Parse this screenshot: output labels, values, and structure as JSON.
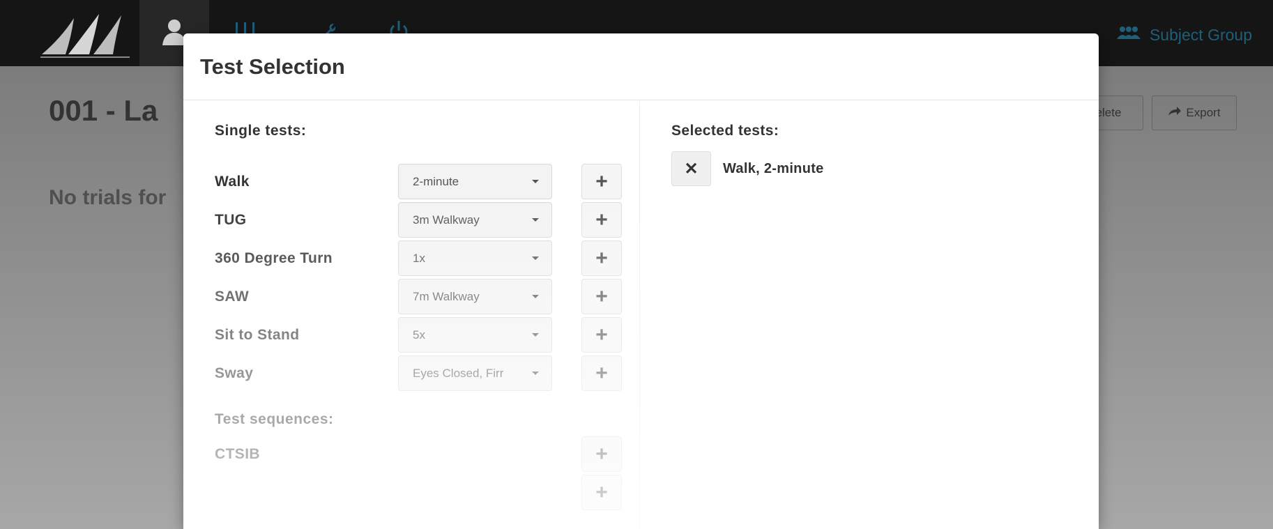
{
  "nav": {
    "subject_group_label": "Subject Group",
    "icons": [
      "logo",
      "user-icon",
      "sliders-icon",
      "wrench-icon",
      "power-icon",
      "users-icon"
    ]
  },
  "background": {
    "title": "001 - La",
    "no_trials": "No trials for",
    "delete_label": "elete",
    "export_label": "Export"
  },
  "modal": {
    "title": "Test Selection",
    "single_tests_header": "Single tests:",
    "single_tests": [
      {
        "label": "Walk",
        "option": "2-minute"
      },
      {
        "label": "TUG",
        "option": "3m Walkway"
      },
      {
        "label": "360 Degree Turn",
        "option": "1x"
      },
      {
        "label": "SAW",
        "option": "7m Walkway"
      },
      {
        "label": "Sit to Stand",
        "option": "5x"
      },
      {
        "label": "Sway",
        "option": "Eyes Closed, Firr"
      }
    ],
    "sequences_header": "Test sequences:",
    "sequences": [
      {
        "label": "CTSIB"
      }
    ],
    "add_symbol": "+",
    "selected_header": "Selected tests:",
    "selected": [
      {
        "label": "Walk, 2-minute",
        "remove_symbol": "✕"
      }
    ]
  },
  "colors": {
    "topbar": "#151515",
    "accent": "#1f5f7a"
  }
}
